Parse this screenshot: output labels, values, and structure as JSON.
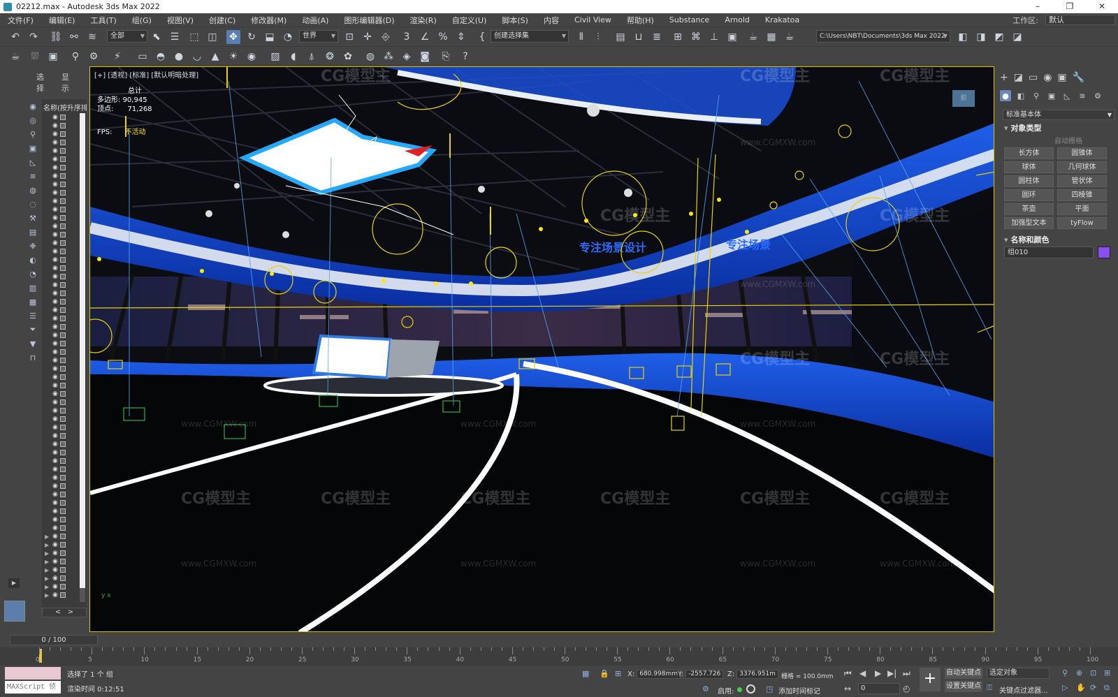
{
  "window": {
    "title": "02212.max - Autodesk 3ds Max 2022",
    "min": "–",
    "max": "❐",
    "close": "✕"
  },
  "menu": [
    "文件(F)",
    "编辑(E)",
    "工具(T)",
    "组(G)",
    "视图(V)",
    "创建(C)",
    "修改器(M)",
    "动画(A)",
    "图形编辑器(D)",
    "渲染(R)",
    "自定义(U)",
    "脚本(S)",
    "内容",
    "Civil View",
    "帮助(H)",
    "Substance",
    "Arnold",
    "Krakatoa"
  ],
  "workspace": {
    "label": "工作区:",
    "value": "默认"
  },
  "toolbar1": {
    "filter": "全部",
    "refcoord": "世界",
    "selset": "创建选择集",
    "path": "C:\\Users\\NBT\\Documents\\3ds Max 2022"
  },
  "left": {
    "tab_select": "选择",
    "tab_display": "显示",
    "header": "名称(按升序排",
    "scroll_left": "<",
    "scroll_right": ">"
  },
  "viewport": {
    "label": "[+] [透视] [标准] [默认明暗处理]",
    "stats_total": "总计",
    "polys_label": "多边形:",
    "polys": "90,945",
    "verts_label": "顶点:",
    "verts": "71,268",
    "fps_label": "FPS:",
    "fps": "不活动",
    "cube_label": "前",
    "axis": "y x",
    "watermark_logo": "CG模型主",
    "watermark_url": "www.CGMXW.com",
    "screen_text_1": "专注场景设计",
    "screen_text_2": "专注场景"
  },
  "command_panel": {
    "tabs": [
      "+",
      "◪",
      "▭",
      "◉",
      "▣",
      "🔧"
    ],
    "category": "标准基本体",
    "rollout_object_type": "对象类型",
    "autogrid": "自动栅格",
    "buttons": [
      "长方体",
      "圆锥体",
      "球体",
      "几何球体",
      "圆柱体",
      "管状体",
      "圆环",
      "四棱锥",
      "茶壶",
      "平面",
      "加强型文本",
      "tyFlow"
    ],
    "rollout_name_color": "名称和颜色",
    "name_value": "组010",
    "swatch_color": "#8a4ff0"
  },
  "timeline": {
    "frame": "0 / 100",
    "ticks": [
      "0",
      "5",
      "10",
      "15",
      "20",
      "25",
      "30",
      "35",
      "40",
      "45",
      "50",
      "55",
      "60",
      "65",
      "70",
      "75",
      "80",
      "85",
      "90",
      "95",
      "100"
    ]
  },
  "status": {
    "maxscript": "MAXScript 侦",
    "selected": "选择了 1 个 组",
    "render_time": "渲染时间  0:12:51",
    "x_label": "X:",
    "x": "680.998mm",
    "y_label": "Y:",
    "y": "-2557.726",
    "z_label": "Z:",
    "z": "3376.951m",
    "grid": "栅格 = 100.0mm",
    "enable": "启用:",
    "add_time_tag": "添加时间标记",
    "auto_key": "自动关键点",
    "set_key": "设置关键点",
    "selected_obj": "选定对象",
    "key_filter": "关键点过滤器...",
    "frame_field": "0"
  }
}
